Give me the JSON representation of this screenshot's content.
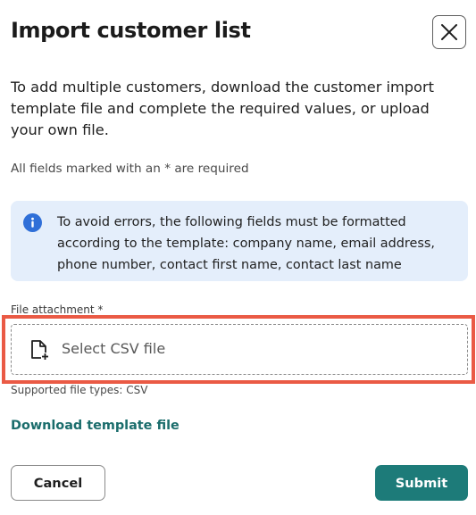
{
  "dialog": {
    "title": "Import customer list",
    "close_icon": "close-icon",
    "intro": "To add multiple customers, download the customer import template file and complete the required values, or upload your own file.",
    "required_note": "All fields marked with an * are required"
  },
  "info_banner": {
    "icon": "info-icon",
    "text": "To avoid errors, the following fields must be formatted according to the template: company name, email address, phone number, contact first name, contact last name",
    "color": "#e4eefb"
  },
  "file_field": {
    "label": "File attachment *",
    "placeholder": "Select CSV file",
    "icon": "file-add-icon",
    "helper": "Supported file types: CSV",
    "highlight_color": "#ea5a45"
  },
  "links": {
    "download_template": "Download template file"
  },
  "footer": {
    "cancel_label": "Cancel",
    "submit_label": "Submit",
    "accent": "#1d7b79"
  }
}
